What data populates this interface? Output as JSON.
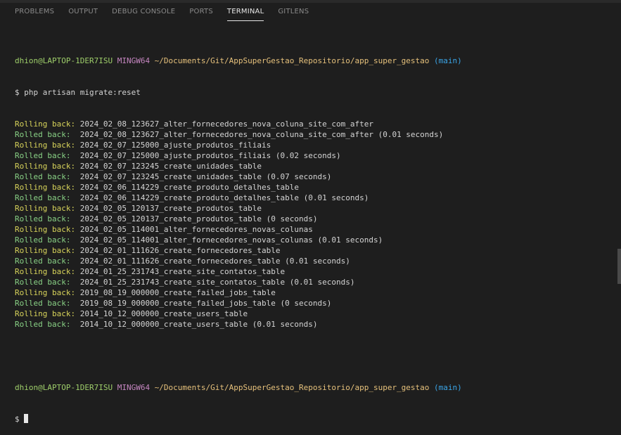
{
  "tabs": [
    {
      "label": "PROBLEMS"
    },
    {
      "label": "OUTPUT"
    },
    {
      "label": "DEBUG CONSOLE"
    },
    {
      "label": "PORTS"
    },
    {
      "label": "TERMINAL"
    },
    {
      "label": "GITLENS"
    }
  ],
  "prompt": {
    "user": "dhion@LAPTOP-1DER7ISU",
    "env": "MINGW64",
    "path": "~/Documents/Git/AppSuperGestao_Repositorio/app_super_gestao",
    "branch": "(main)",
    "symbol": "$",
    "command": "php artisan migrate:reset"
  },
  "output": [
    {
      "label": "Rolling back:",
      "text": " 2024_02_08_123627_alter_fornecedores_nova_coluna_site_com_after"
    },
    {
      "label": "Rolled back:",
      "text": "  2024_02_08_123627_alter_fornecedores_nova_coluna_site_com_after (0.01 seconds)"
    },
    {
      "label": "Rolling back:",
      "text": " 2024_02_07_125000_ajuste_produtos_filiais"
    },
    {
      "label": "Rolled back:",
      "text": "  2024_02_07_125000_ajuste_produtos_filiais (0.02 seconds)"
    },
    {
      "label": "Rolling back:",
      "text": " 2024_02_07_123245_create_unidades_table"
    },
    {
      "label": "Rolled back:",
      "text": "  2024_02_07_123245_create_unidades_table (0.07 seconds)"
    },
    {
      "label": "Rolling back:",
      "text": " 2024_02_06_114229_create_produto_detalhes_table"
    },
    {
      "label": "Rolled back:",
      "text": "  2024_02_06_114229_create_produto_detalhes_table (0.01 seconds)"
    },
    {
      "label": "Rolling back:",
      "text": " 2024_02_05_120137_create_produtos_table"
    },
    {
      "label": "Rolled back:",
      "text": "  2024_02_05_120137_create_produtos_table (0 seconds)"
    },
    {
      "label": "Rolling back:",
      "text": " 2024_02_05_114001_alter_fornecedores_novas_colunas"
    },
    {
      "label": "Rolled back:",
      "text": "  2024_02_05_114001_alter_fornecedores_novas_colunas (0.01 seconds)"
    },
    {
      "label": "Rolling back:",
      "text": " 2024_02_01_111626_create_fornecedores_table"
    },
    {
      "label": "Rolled back:",
      "text": "  2024_02_01_111626_create_fornecedores_table (0.01 seconds)"
    },
    {
      "label": "Rolling back:",
      "text": " 2024_01_25_231743_create_site_contatos_table"
    },
    {
      "label": "Rolled back:",
      "text": "  2024_01_25_231743_create_site_contatos_table (0.01 seconds)"
    },
    {
      "label": "Rolling back:",
      "text": " 2019_08_19_000000_create_failed_jobs_table"
    },
    {
      "label": "Rolled back:",
      "text": "  2019_08_19_000000_create_failed_jobs_table (0 seconds)"
    },
    {
      "label": "Rolling back:",
      "text": " 2014_10_12_000000_create_users_table"
    },
    {
      "label": "Rolled back:",
      "text": "  2014_10_12_000000_create_users_table (0.01 seconds)"
    }
  ]
}
